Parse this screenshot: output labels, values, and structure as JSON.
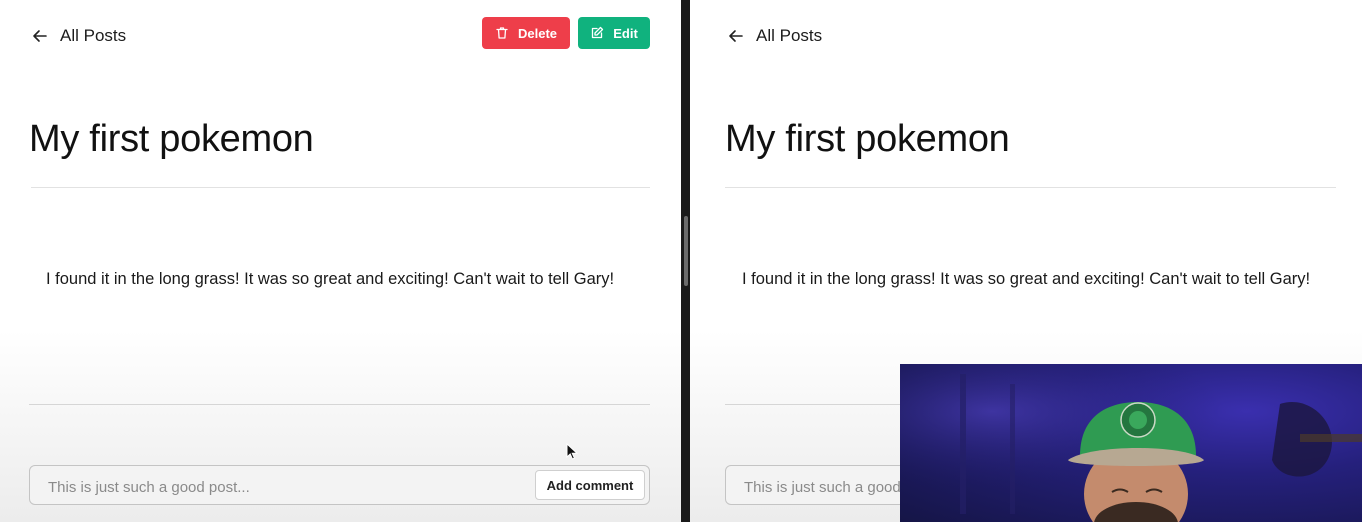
{
  "left_pane": {
    "back_label": "All Posts",
    "delete_label": "Delete",
    "edit_label": "Edit",
    "post_title": "My first pokemon",
    "post_body": "I found it in the long grass! It was so great and exciting! Can't wait to tell Gary!",
    "comment": {
      "placeholder": "This is just such a good post...",
      "button_label": "Add comment"
    }
  },
  "right_pane": {
    "back_label": "All Posts",
    "post_title": "My first pokemon",
    "post_body": "I found it in the long grass! It was so great and exciting! Can't wait to tell Gary!",
    "comment": {
      "placeholder": "This is just such a good post..."
    }
  },
  "colors": {
    "delete": "#ee3e4a",
    "edit": "#10b27e",
    "divider": "#1a1a1a"
  },
  "icons": [
    "arrow-left-icon",
    "trash-icon",
    "pencil-square-icon",
    "mouse-pointer-icon"
  ]
}
